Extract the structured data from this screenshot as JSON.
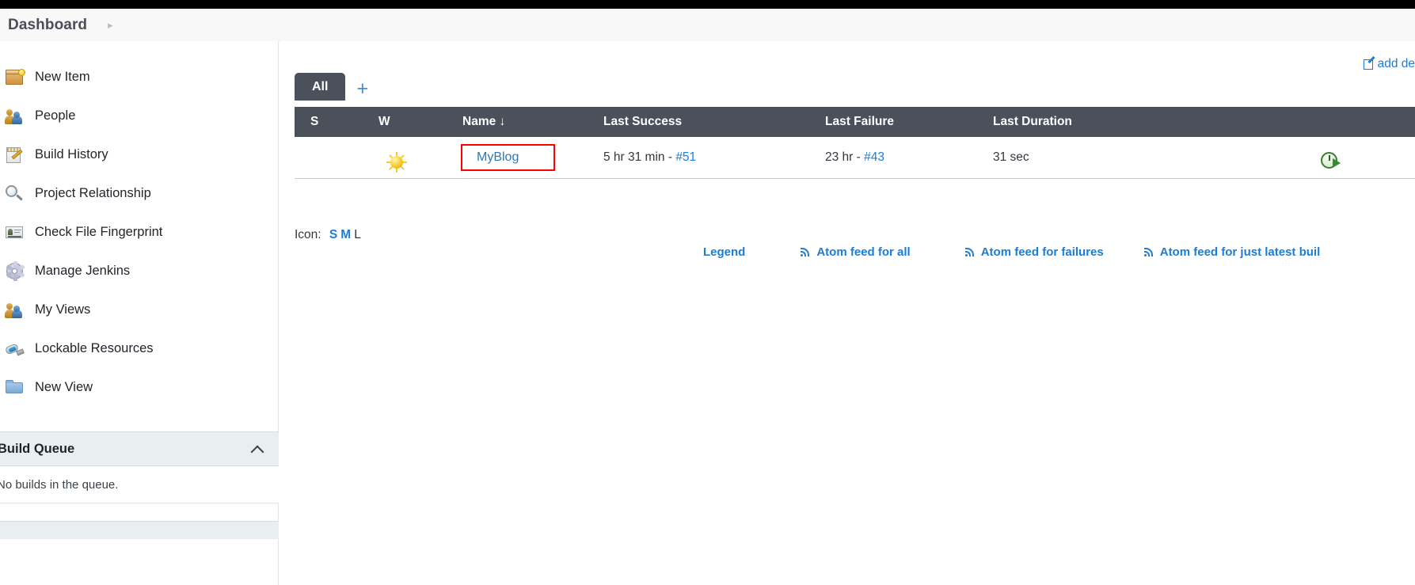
{
  "breadcrumb": {
    "title": "Dashboard",
    "caret": "▸"
  },
  "sidebar": {
    "items": [
      {
        "label": "New Item",
        "icon": "new-item-box-icon"
      },
      {
        "label": "People",
        "icon": "people-icon"
      },
      {
        "label": "Build History",
        "icon": "notepad-pencil-icon"
      },
      {
        "label": "Project Relationship",
        "icon": "magnifier-icon"
      },
      {
        "label": "Check File Fingerprint",
        "icon": "id-card-icon"
      },
      {
        "label": "Manage Jenkins",
        "icon": "gear-icon"
      },
      {
        "label": "My Views",
        "icon": "people-icon"
      },
      {
        "label": "Lockable Resources",
        "icon": "usb-stick-icon"
      },
      {
        "label": "New View",
        "icon": "folder-icon"
      }
    ],
    "build_queue": {
      "title": "Build Queue",
      "collapse_icon": "chevron-up-icon",
      "empty_message": "No builds in the queue."
    }
  },
  "main": {
    "add_description": {
      "label": "add de",
      "icon": "edit-pencil-icon"
    },
    "tabs": [
      {
        "label": "All",
        "active": true
      }
    ],
    "add_tab_label": "+",
    "table": {
      "columns": [
        "S",
        "W",
        "Name  ↓",
        "Last Success",
        "Last Failure",
        "Last Duration",
        ""
      ],
      "rows": [
        {
          "status": "blue-ball-success-icon",
          "weather": "sunny-icon",
          "name": "MyBlog",
          "name_highlighted": true,
          "last_success_text": "5 hr 31 min - ",
          "last_success_build": "#51",
          "last_failure_text": "23 hr - ",
          "last_failure_build": "#43",
          "last_duration": "31 sec",
          "action_icon": "schedule-build-icon"
        }
      ]
    },
    "icon_size": {
      "label": "Icon:",
      "options": [
        "S",
        "M",
        "L"
      ],
      "selected": "L"
    },
    "feeds": {
      "legend": "Legend",
      "items": [
        "Atom feed for all",
        "Atom feed for failures",
        "Atom feed for just latest buil"
      ]
    }
  },
  "colors": {
    "header_dark": "#4b515a",
    "link_blue": "#1c7cd6",
    "highlight_red": "#ff0000",
    "panel_grey": "#e9eef0"
  }
}
